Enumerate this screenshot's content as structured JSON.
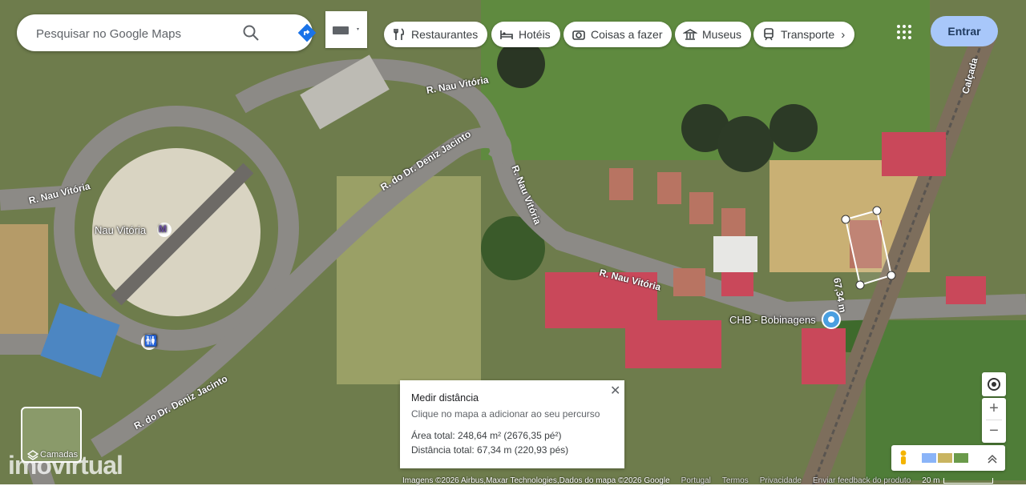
{
  "search": {
    "placeholder": "Pesquisar no Google Maps"
  },
  "chips": [
    {
      "label": "Restaurantes",
      "icon": "fork-knife-icon"
    },
    {
      "label": "Hotéis",
      "icon": "bed-icon"
    },
    {
      "label": "Coisas a fazer",
      "icon": "camera-icon"
    },
    {
      "label": "Museus",
      "icon": "museum-icon"
    },
    {
      "label": "Transporte",
      "icon": "train-icon"
    }
  ],
  "signin_label": "Entrar",
  "map": {
    "labels": {
      "rua_nau_vitoria_west": "R. Nau Vitória",
      "rua_nau_vitoria_north": "R. Nau Vitória",
      "rua_nau_vitoria_diag": "R. Nau Vitória",
      "rua_nau_vitoria_east": "R. Nau Vitória",
      "rua_deniz_north": "R. do Dr. Deniz Jacinto",
      "rua_deniz_south": "R. do Dr. Deniz Jacinto",
      "calcada": "Calçada",
      "metro_station": "Nau Vitória",
      "business": "CHB - Bobinagens",
      "segment": "67,34 m"
    },
    "layers_label": "Camadas",
    "watermark": "imovirtual"
  },
  "measure": {
    "title": "Medir distância",
    "hint": "Clique no mapa a adicionar ao seu percurso",
    "area": "Área total: 248,64 m² (2676,35 pé²)",
    "distance": "Distância total: 67,34 m (220,93 pés)"
  },
  "footer": {
    "attribution": "Imagens ©2026 Airbus,Maxar Technologies,Dados do mapa ©2026 Google",
    "country": "Portugal",
    "terms": "Termos",
    "privacy": "Privacidade",
    "feedback": "Enviar feedback do produto",
    "scale": "20 m"
  },
  "colors": {
    "accent": "#a8c7fa",
    "map_green": "#6f7d4e",
    "roof": "#c9485a"
  }
}
